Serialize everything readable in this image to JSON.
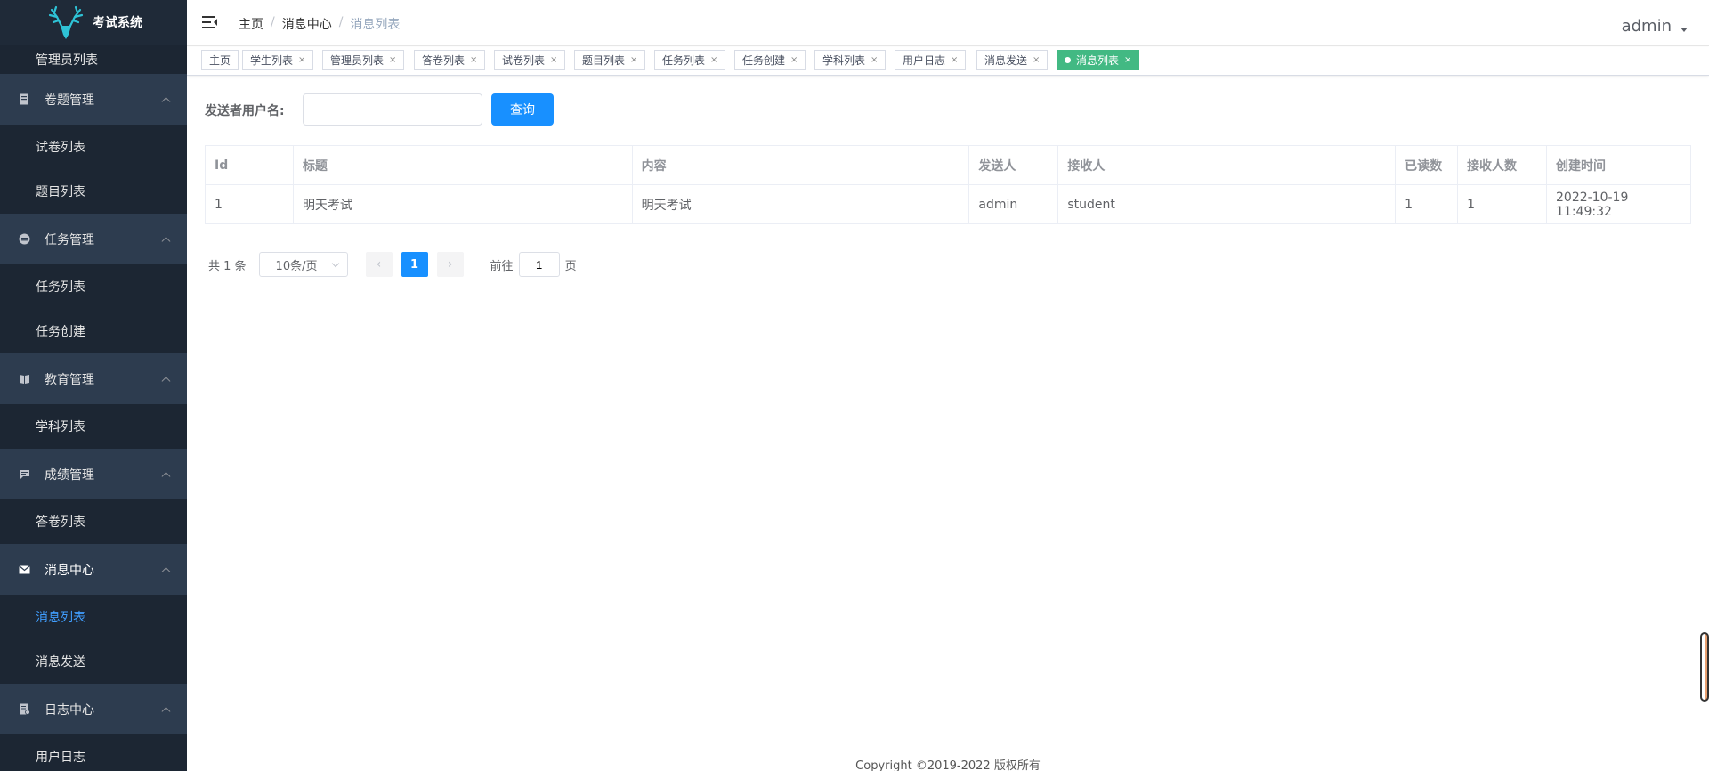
{
  "app": {
    "title": "考试系统"
  },
  "colors": {
    "sidebar_bg": "#24303f",
    "accent": "#1890ff",
    "active_tag": "#42b983",
    "active_menu": "#409eff"
  },
  "sidebar": {
    "items": [
      {
        "type": "sub",
        "label": "管理员列表"
      },
      {
        "type": "group",
        "label": "卷题管理",
        "icon": "document-icon"
      },
      {
        "type": "sub",
        "label": "试卷列表"
      },
      {
        "type": "sub",
        "label": "题目列表"
      },
      {
        "type": "group",
        "label": "任务管理",
        "icon": "task-icon"
      },
      {
        "type": "sub",
        "label": "任务列表"
      },
      {
        "type": "sub",
        "label": "任务创建"
      },
      {
        "type": "group",
        "label": "教育管理",
        "icon": "book-icon"
      },
      {
        "type": "sub",
        "label": "学科列表"
      },
      {
        "type": "group",
        "label": "成绩管理",
        "icon": "chat-icon"
      },
      {
        "type": "sub",
        "label": "答卷列表"
      },
      {
        "type": "group",
        "label": "消息中心",
        "icon": "mail-icon"
      },
      {
        "type": "sub",
        "label": "消息列表",
        "active": true
      },
      {
        "type": "sub",
        "label": "消息发送"
      },
      {
        "type": "group",
        "label": "日志中心",
        "icon": "log-icon"
      },
      {
        "type": "sub",
        "label": "用户日志"
      }
    ]
  },
  "header": {
    "breadcrumb": [
      "主页",
      "消息中心",
      "消息列表"
    ],
    "user": "admin"
  },
  "tags": [
    {
      "label": "主页",
      "closable": false
    },
    {
      "label": "学生列表",
      "closable": true
    },
    {
      "label": "管理员列表",
      "closable": true
    },
    {
      "label": "答卷列表",
      "closable": true
    },
    {
      "label": "试卷列表",
      "closable": true
    },
    {
      "label": "题目列表",
      "closable": true
    },
    {
      "label": "任务列表",
      "closable": true
    },
    {
      "label": "任务创建",
      "closable": true
    },
    {
      "label": "学科列表",
      "closable": true
    },
    {
      "label": "用户日志",
      "closable": true
    },
    {
      "label": "消息发送",
      "closable": true
    },
    {
      "label": "消息列表",
      "closable": true,
      "active": true
    }
  ],
  "search": {
    "label": "发送者用户名:",
    "value": "",
    "placeholder": "",
    "button": "查询"
  },
  "table": {
    "columns": [
      "Id",
      "标题",
      "内容",
      "发送人",
      "接收人",
      "已读数",
      "接收人数",
      "创建时间"
    ],
    "rows": [
      [
        "1",
        "明天考试",
        "明天考试",
        "admin",
        "student",
        "1",
        "1",
        "2022-10-19 11:49:32"
      ]
    ]
  },
  "pagination": {
    "total": "共 1 条",
    "page_size": "10条/页",
    "current": "1",
    "goto_prefix": "前往",
    "goto_value": "1",
    "goto_suffix": "页"
  },
  "footer": "Copyright ©2019-2022 版权所有"
}
